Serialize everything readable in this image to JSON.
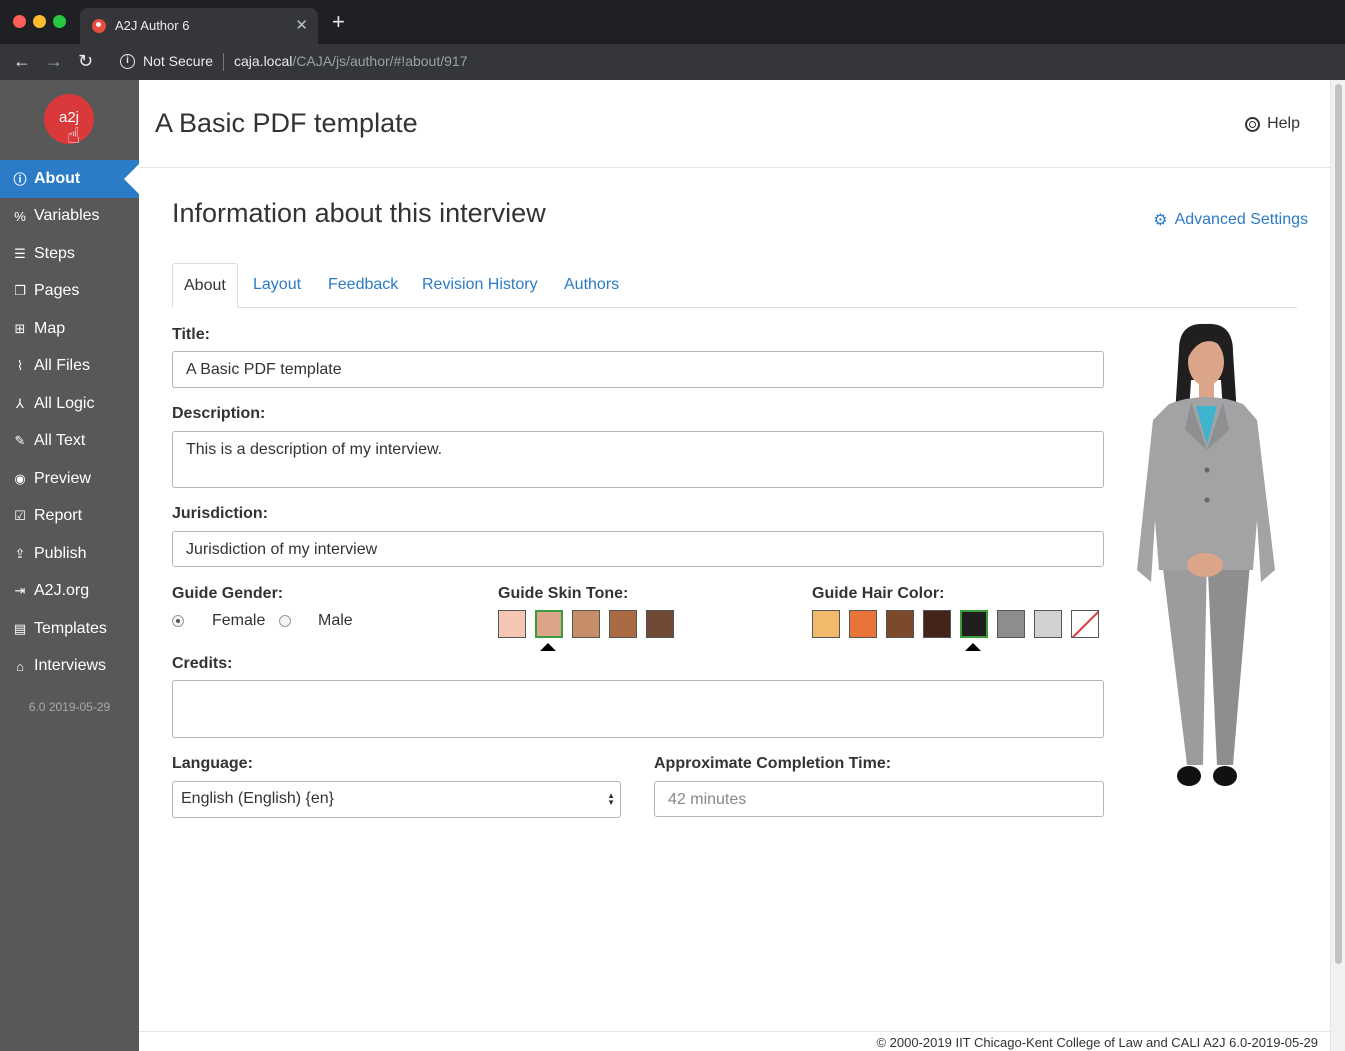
{
  "browser": {
    "tab_title": "A2J Author 6",
    "security_label": "Not Secure",
    "url_host": "caja.local",
    "url_path": "/CAJA/js/author/#!about/917"
  },
  "sidebar": {
    "logo_text": "a2j",
    "items": [
      {
        "label": "About",
        "icon": "info-icon",
        "active": true
      },
      {
        "label": "Variables",
        "icon": "percent-icon"
      },
      {
        "label": "Steps",
        "icon": "list-icon"
      },
      {
        "label": "Pages",
        "icon": "pages-icon"
      },
      {
        "label": "Map",
        "icon": "sitemap-icon"
      },
      {
        "label": "All Files",
        "icon": "paperclip-icon"
      },
      {
        "label": "All Logic",
        "icon": "logic-icon"
      },
      {
        "label": "All Text",
        "icon": "pencil-icon"
      },
      {
        "label": "Preview",
        "icon": "eye-icon"
      },
      {
        "label": "Report",
        "icon": "clipboard-icon"
      },
      {
        "label": "Publish",
        "icon": "upload-icon"
      },
      {
        "label": "A2J.org",
        "icon": "login-icon"
      },
      {
        "label": "Templates",
        "icon": "document-icon"
      },
      {
        "label": "Interviews",
        "icon": "bank-icon"
      }
    ],
    "version": "6.0 2019-05-29"
  },
  "header": {
    "title": "A Basic PDF template",
    "help_label": "Help"
  },
  "content": {
    "section_title": "Information about this interview",
    "advanced_settings_label": "Advanced Settings",
    "tabs": [
      "About",
      "Layout",
      "Feedback",
      "Revision History",
      "Authors"
    ],
    "title_label": "Title:",
    "title_value": "A Basic PDF template",
    "description_label": "Description:",
    "description_value": "This is a description of my interview.",
    "jurisdiction_label": "Jurisdiction:",
    "jurisdiction_value": "Jurisdiction of my interview",
    "gender_label": "Guide Gender:",
    "gender_female": "Female",
    "gender_male": "Male",
    "gender_selected": "Female",
    "skin_label": "Guide Skin Tone:",
    "skin_tones": [
      "#f3c7b3",
      "#dba589",
      "#c68e68",
      "#a96a44",
      "#704a37"
    ],
    "skin_selected": 1,
    "hair_label": "Guide Hair Color:",
    "hair_colors": [
      "#f2b96a",
      "#e8743a",
      "#7c4a2a",
      "#43241a",
      "#211e1f",
      "#8d8d8d",
      "#d1d1d1",
      "none"
    ],
    "hair_selected": 4,
    "credits_label": "Credits:",
    "credits_value": "",
    "language_label": "Language:",
    "language_value": "English (English) {en}",
    "completion_label": "Approximate Completion Time:",
    "completion_placeholder": "42 minutes"
  },
  "footer": {
    "text": "© 2000-2019 IIT Chicago-Kent College of Law and CALI A2J 6.0-2019-05-29"
  }
}
